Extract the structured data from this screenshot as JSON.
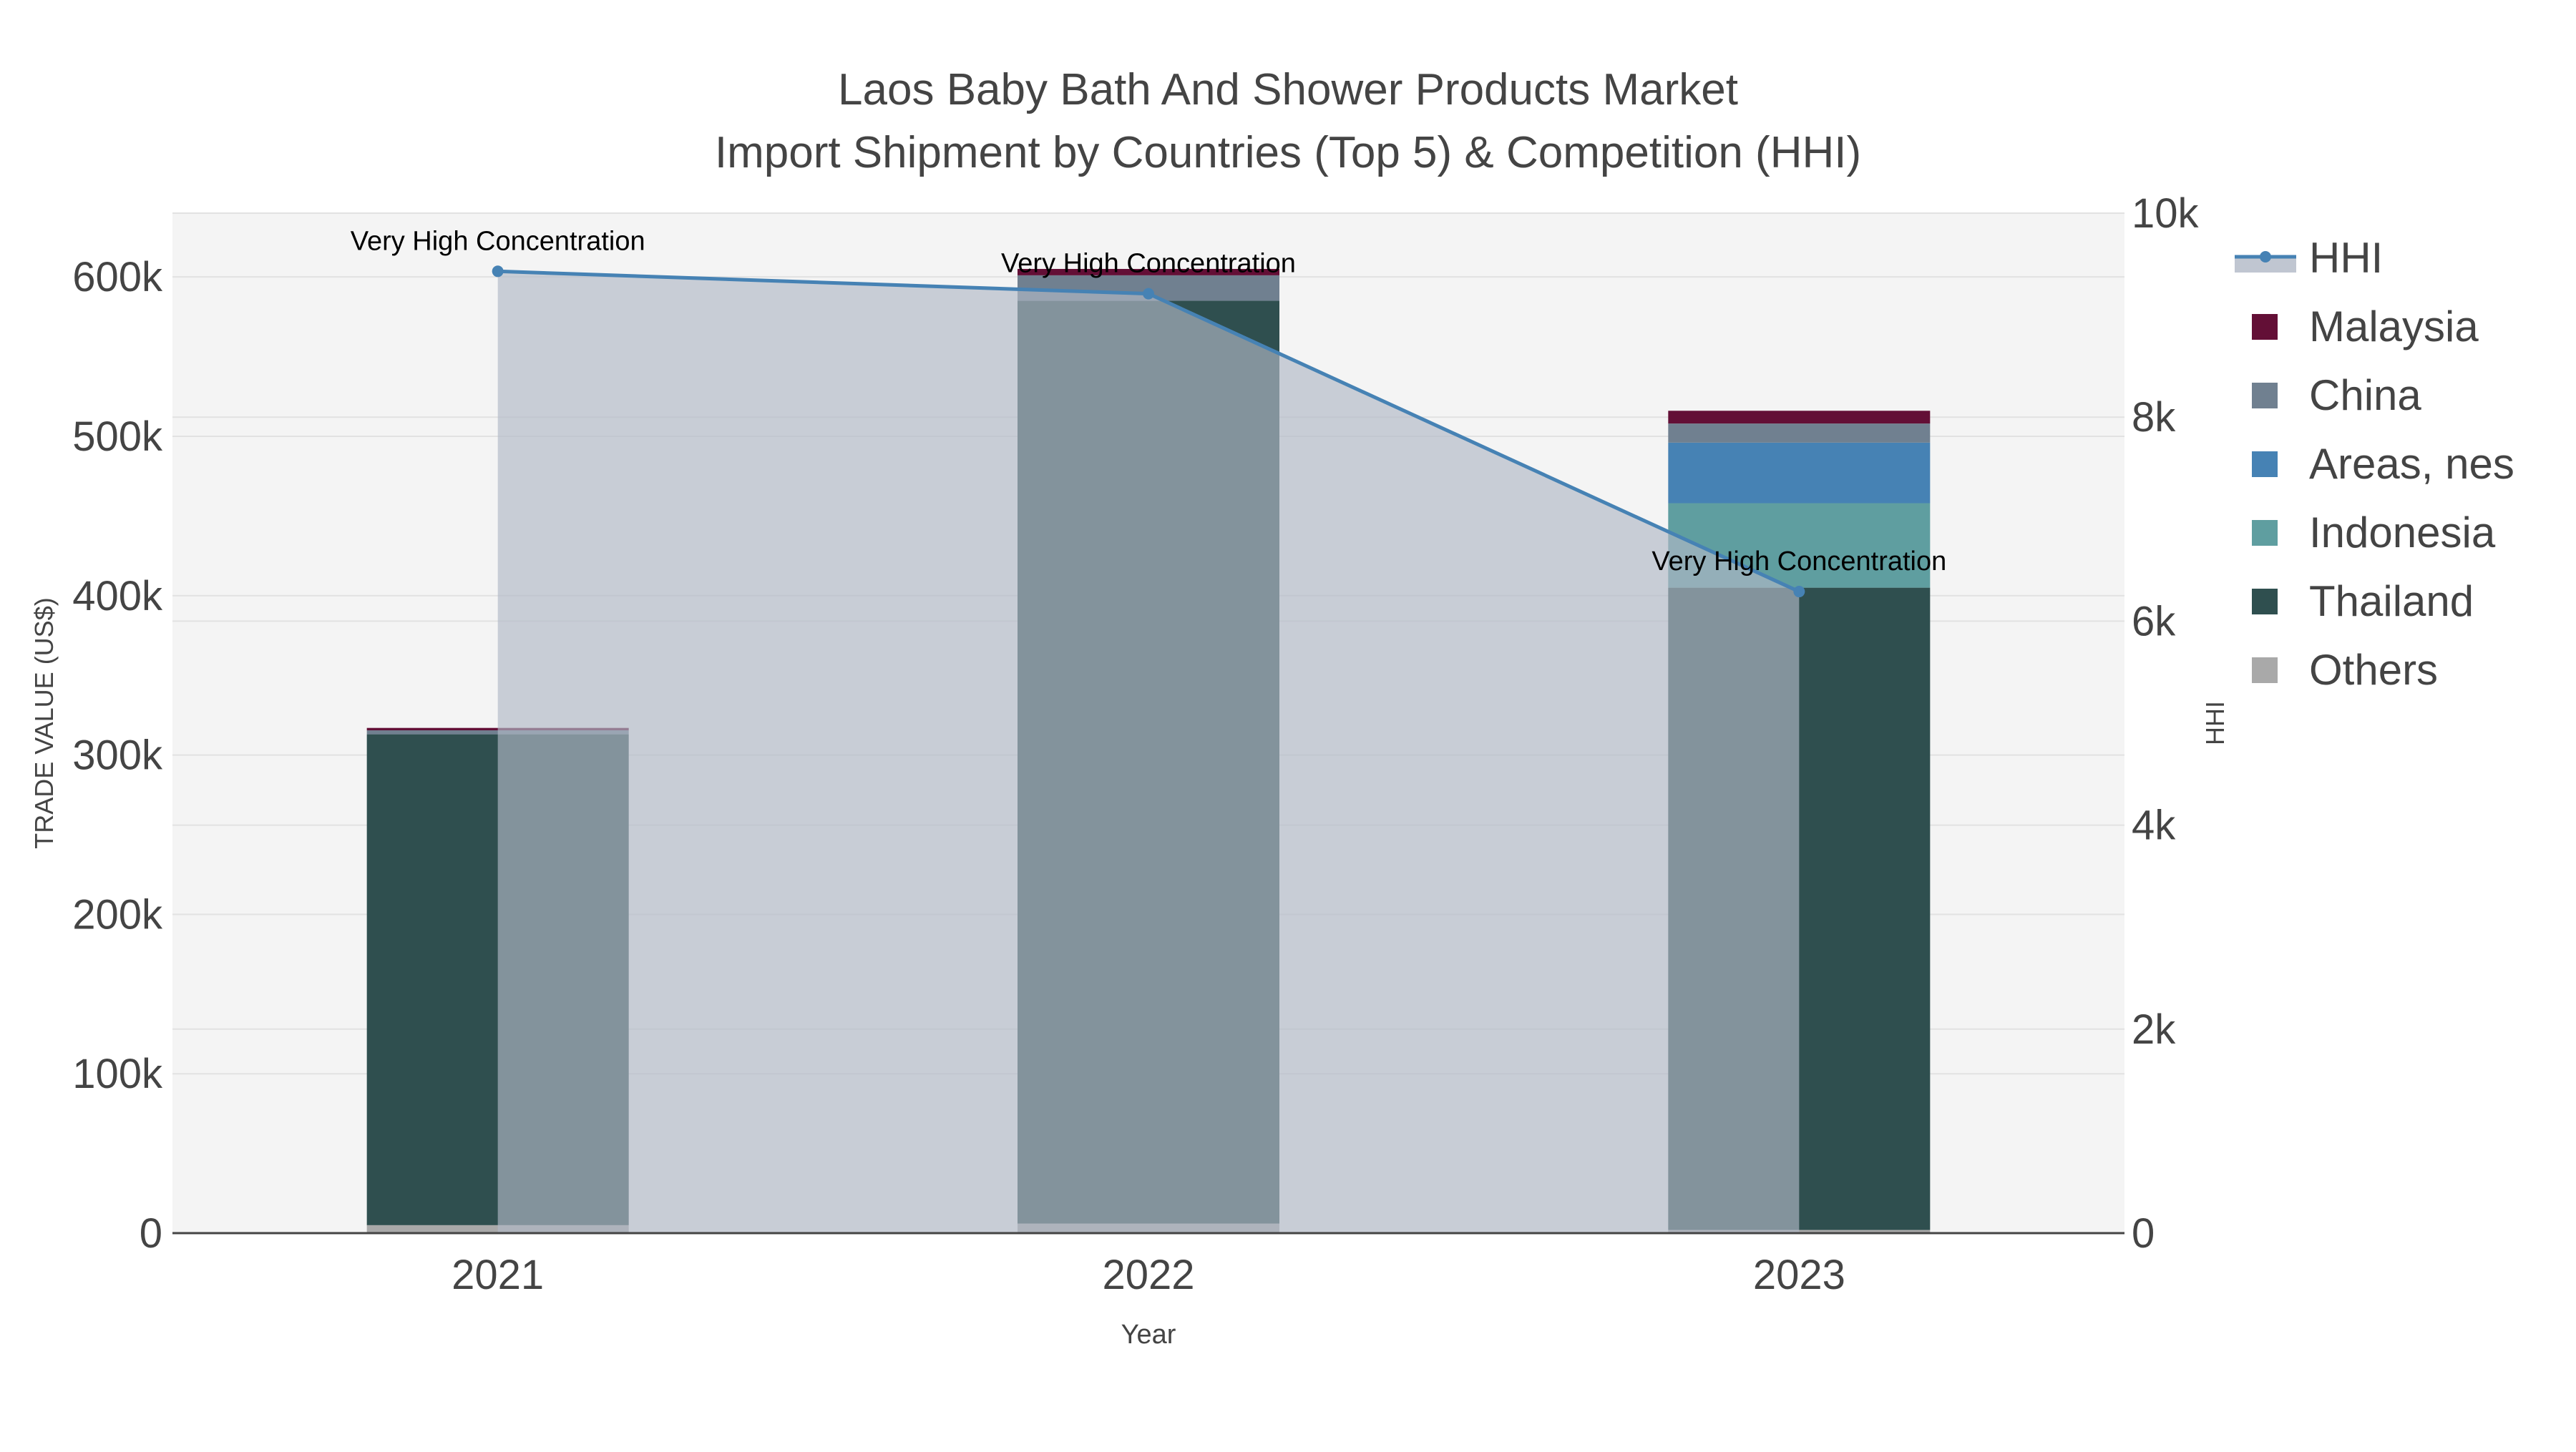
{
  "chart_data": {
    "type": "bar",
    "title": "Laos Baby Bath And Shower Products Market",
    "subtitle": "Import Shipment by Countries (Top 5) & Competition (HHI)",
    "xlabel": "Year",
    "ylabel": "TRADE VALUE (US$)",
    "y2label": "HHI",
    "categories": [
      "2021",
      "2022",
      "2023"
    ],
    "ylim": [
      0,
      640000
    ],
    "y2lim": [
      0,
      10000
    ],
    "yticks": [
      0,
      100000,
      200000,
      300000,
      400000,
      500000,
      600000
    ],
    "ytick_labels": [
      "0",
      "100k",
      "200k",
      "300k",
      "400k",
      "500k",
      "600k"
    ],
    "y2ticks": [
      0,
      2000,
      4000,
      6000,
      8000,
      10000
    ],
    "y2tick_labels": [
      "0",
      "2k",
      "4k",
      "6k",
      "8k",
      "10k"
    ],
    "series": [
      {
        "name": "Others",
        "color": "#a9a9a9",
        "values": [
          5000,
          6000,
          2000
        ]
      },
      {
        "name": "Thailand",
        "color": "#2f4f4f",
        "values": [
          308000,
          579000,
          403000
        ]
      },
      {
        "name": "Indonesia",
        "color": "#5f9ea0",
        "values": [
          0,
          0,
          53000
        ]
      },
      {
        "name": "Areas, nes",
        "color": "#4682b4",
        "values": [
          0,
          0,
          38000
        ]
      },
      {
        "name": "China",
        "color": "#708090",
        "values": [
          2500,
          16000,
          12000
        ]
      },
      {
        "name": "Malaysia",
        "color": "#630f36",
        "values": [
          1500,
          4000,
          8000
        ]
      }
    ],
    "line": {
      "name": "HHI",
      "color": "#4682b4",
      "values": [
        9430,
        9210,
        6290
      ]
    },
    "annotations": [
      "Very High Concentration",
      "Very High Concentration",
      "Very High Concentration"
    ],
    "legend_order": [
      "HHI",
      "Malaysia",
      "China",
      "Areas, nes",
      "Indonesia",
      "Thailand",
      "Others"
    ],
    "legend_position": "right",
    "grid": true
  }
}
